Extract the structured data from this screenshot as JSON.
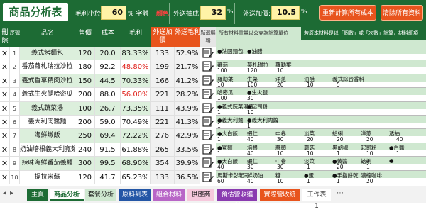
{
  "header": {
    "title": "商品分析表",
    "margin_min_label": "毛利小於",
    "margin_min_value": "60",
    "margin_min_suffix": "% 字體",
    "margin_min_color_text": "顏色",
    "delivery_fee_label": "外送抽成:",
    "delivery_fee_value": "32",
    "delivery_fee_suffix": "%",
    "delivery_price_label": "外送加價:",
    "delivery_price_value": "10.5",
    "delivery_price_suffix": "%",
    "recalc_button": "重新計算所有成本",
    "clear_button": "清除所有資料"
  },
  "columns": {
    "delete": "刪除",
    "seq": "序號",
    "name": "品名",
    "price": "售價",
    "cost": "成本",
    "margin": "毛利",
    "delivery_price": "外送加價",
    "delivery_margin": "外送毛利",
    "edit": "點選編輯",
    "materials": "所有材料重量以公克為計算單位",
    "note": "若原本材料是以「個數」或「次數」計算，材料細項"
  },
  "rows": [
    {
      "seq": "1",
      "name": "義式烤麵包",
      "price": "120",
      "cost": "20.0",
      "margin": "83.33%",
      "dprice": "133",
      "dmargin": "52.9%",
      "low": false
    },
    {
      "seq": "2",
      "name": "番茄蘿札瑞拉沙拉",
      "price": "180",
      "cost": "92.2",
      "margin": "48.80%",
      "dprice": "199",
      "dmargin": "21.7%",
      "low": true
    },
    {
      "seq": "3",
      "name": "義式香草精肉沙拉",
      "price": "150",
      "cost": "44.5",
      "margin": "70.33%",
      "dprice": "166",
      "dmargin": "41.2%",
      "low": false
    },
    {
      "seq": "4",
      "name": "義式生火腿哈密瓜",
      "price": "200",
      "cost": "88.0",
      "margin": "56.00%",
      "dprice": "221",
      "dmargin": "28.2%",
      "low": true
    },
    {
      "seq": "5",
      "name": "義式蔬菜湯",
      "price": "100",
      "cost": "26.7",
      "margin": "73.35%",
      "dprice": "111",
      "dmargin": "43.9%",
      "low": false
    },
    {
      "seq": "6",
      "name": "義大利肉醬麵",
      "price": "200",
      "cost": "59.0",
      "margin": "70.49%",
      "dprice": "221",
      "dmargin": "41.3%",
      "low": false
    },
    {
      "seq": "7",
      "name": "海鮮燉飯",
      "price": "250",
      "cost": "69.4",
      "margin": "72.22%",
      "dprice": "276",
      "dmargin": "42.9%",
      "low": false
    },
    {
      "seq": "8",
      "name": "奶油培根義大利寬麵",
      "price": "240",
      "cost": "91.5",
      "margin": "61.88%",
      "dprice": "265",
      "dmargin": "33.5%",
      "low": false
    },
    {
      "seq": "9",
      "name": "辣味海鮮番茄義麵",
      "price": "300",
      "cost": "99.5",
      "margin": "68.90%",
      "dprice": "354",
      "dmargin": "39.9%",
      "low": false
    },
    {
      "seq": "10",
      "name": "提拉米蘇",
      "price": "120",
      "cost": "41.7",
      "margin": "65.23%",
      "dprice": "133",
      "dmargin": "36.5%",
      "low": false
    }
  ],
  "ingredients": [
    {
      "top": "●法國麵包",
      "items": [
        "●油醋"
      ],
      "vals": []
    },
    {
      "top": "蕃茄",
      "items": [
        "莫札瑞拉",
        "羅勒葉"
      ],
      "vals": [
        "100",
        "120",
        "10"
      ]
    },
    {
      "top": "羅勒葉",
      "items": [
        "生菜",
        "洋蔥",
        "油醋",
        "義式綜合香料"
      ],
      "vals": [
        "10",
        "100",
        "20",
        "10",
        "5"
      ]
    },
    {
      "top": "哈密瓜",
      "items": [
        "●生火腿"
      ],
      "vals": [
        "100",
        "30"
      ]
    },
    {
      "top": "●義式蔬菜湯底",
      "items": [
        "●起司粉"
      ],
      "vals": [
        "1",
        "10"
      ]
    },
    {
      "top": "●義大利麵",
      "items": [
        "●義大利肉醬"
      ],
      "vals": [
        "1",
        "1"
      ]
    },
    {
      "top": "●大白飯",
      "items": [
        "蝦仁",
        "中卷",
        "淡菜",
        "蛤蜊",
        "洋蔥",
        "透抽"
      ],
      "vals": [
        "1",
        "40",
        "30",
        "20",
        "20",
        "20",
        "40"
      ]
    },
    {
      "top": "●寬麵",
      "items": [
        "培根",
        "蒜頭",
        "蘑菇",
        "黑胡椒",
        "起司粉",
        "●白醬"
      ],
      "vals": [
        "1",
        "40",
        "10",
        "10",
        "1",
        "10",
        "1"
      ]
    },
    {
      "top": "●大白飯",
      "items": [
        "蝦仁",
        "中卷",
        "淡菜",
        "●黃醬",
        "蛤蜊",
        "●"
      ],
      "vals": [
        "40",
        "30",
        "30",
        "1",
        "20",
        "1"
      ]
    },
    {
      "top": "馬斯卡彭起司",
      "items": [
        "鮮奶油",
        "糖",
        "●蛋",
        "●手指餅乾",
        "濃縮咖啡"
      ],
      "vals": [
        "60",
        "40",
        "10",
        "1",
        "1",
        "20"
      ]
    }
  ],
  "tabs": [
    "主頁",
    "商品分析",
    "套餐分析",
    "原料列表",
    "組合材料",
    "供應商",
    "預估營收獲利",
    "實際營收統計",
    "工作表1"
  ],
  "icons": [
    "memo-edit-icon"
  ],
  "colors": {
    "brand_green": "#1d6b34",
    "accent_orange": "#e8541d",
    "highlight_yellow": "#fff3a6",
    "neg_red": "#e0201a"
  }
}
